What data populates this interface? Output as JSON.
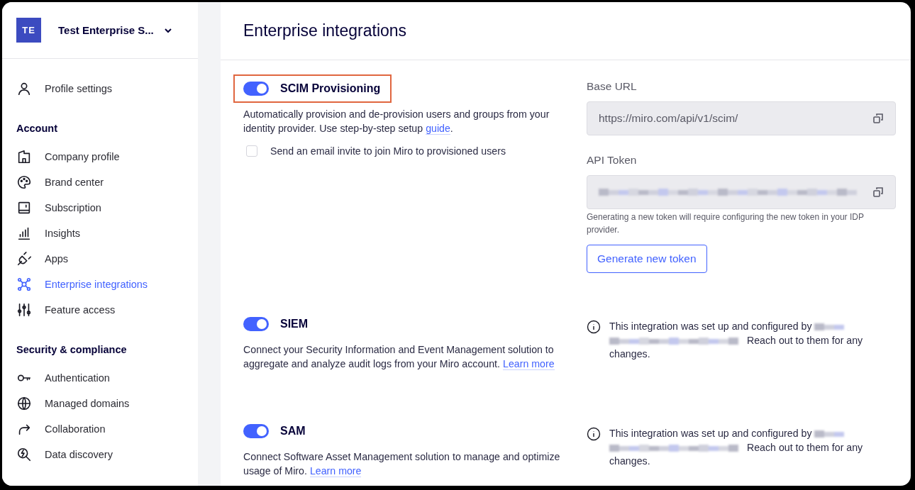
{
  "workspace": {
    "initials": "TE",
    "name": "Test Enterprise S..."
  },
  "sidebar": {
    "sections": [
      {
        "items": [
          {
            "label": "Profile settings",
            "selected": false
          }
        ]
      },
      {
        "heading": "Account",
        "items": [
          {
            "label": "Company profile",
            "selected": false
          },
          {
            "label": "Brand center",
            "selected": false
          },
          {
            "label": "Subscription",
            "selected": false
          },
          {
            "label": "Insights",
            "selected": false
          },
          {
            "label": "Apps",
            "selected": false
          },
          {
            "label": "Enterprise integrations",
            "selected": true
          },
          {
            "label": "Feature access",
            "selected": false
          }
        ]
      },
      {
        "heading": "Security & compliance",
        "items": [
          {
            "label": "Authentication",
            "selected": false
          },
          {
            "label": "Managed domains",
            "selected": false
          },
          {
            "label": "Collaboration",
            "selected": false
          },
          {
            "label": "Data discovery",
            "selected": false
          }
        ]
      }
    ]
  },
  "page_title": "Enterprise integrations",
  "integrations": [
    {
      "kind": "config",
      "name": "SCIM Provisioning",
      "on": true,
      "highlighted": true,
      "description": "Automatically provision and de-provision users and groups from your identity provider. Use step-by-step setup",
      "link": "guide",
      "suffix": ".",
      "checkbox": {
        "label": "Send an email invite to join Miro to provisioned users",
        "checked": false
      },
      "fields": [
        {
          "label": "Base URL",
          "value": "https://miro.com/api/v1/scim/",
          "redacted": false
        },
        {
          "label": "API Token",
          "redacted": true
        }
      ],
      "hint": "Generating a new token will require configuring the new token in your IDP provider.",
      "button": "Generate new token"
    },
    {
      "kind": "note",
      "name": "SIEM",
      "on": true,
      "highlighted": false,
      "description": "Connect your Security Information and Event Management solution to aggregate and analyze audit logs from your Miro account.",
      "link": "Learn more",
      "note_start": "This integration was set up and configured by",
      "note_end": "Reach out to them for any changes."
    },
    {
      "kind": "note",
      "name": "SAM",
      "on": true,
      "highlighted": false,
      "description": "Connect Software Asset Management solution to manage and optimize usage of Miro.",
      "link": "Learn more",
      "note_start": "This integration was set up and configured by",
      "note_end": "Reach out to them for any changes."
    }
  ]
}
